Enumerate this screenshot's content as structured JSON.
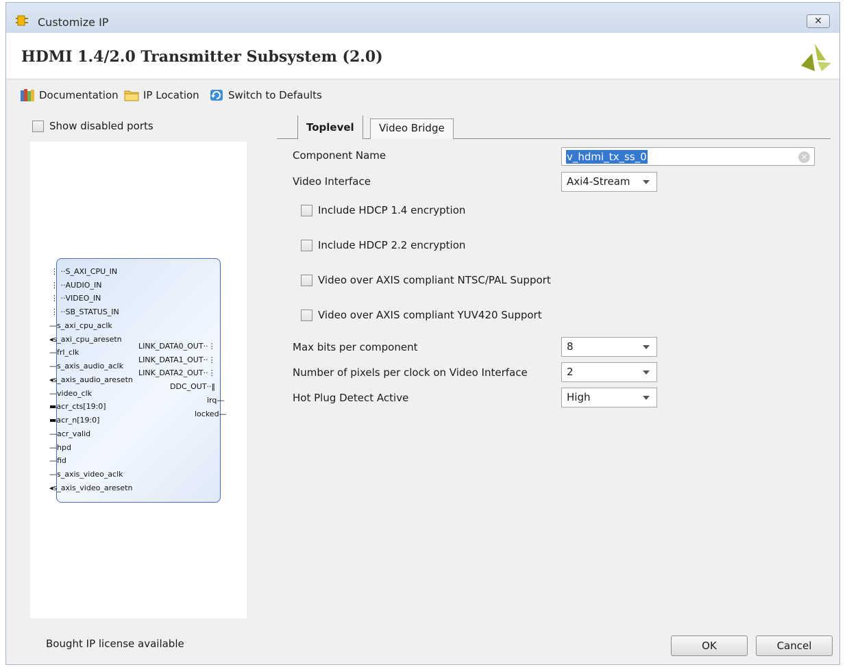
{
  "window": {
    "title": "Customize IP",
    "close_glyph": "✕"
  },
  "header": {
    "ip_title": "HDMI 1.4/2.0 Transmitter Subsystem (2.0)",
    "logo_icon": "xilinx-logo"
  },
  "toolbar": {
    "documentation": "Documentation",
    "ip_location": "IP Location",
    "switch_defaults": "Switch to Defaults"
  },
  "left": {
    "show_disabled_ports": "Show disabled ports",
    "ports_left": [
      "S_AXI_CPU_IN",
      "AUDIO_IN",
      "VIDEO_IN",
      "SB_STATUS_IN",
      "s_axi_cpu_aclk",
      "s_axi_cpu_aresetn",
      "frl_clk",
      "s_axis_audio_aclk",
      "s_axis_audio_aresetn",
      "video_clk",
      "acr_cts[19:0]",
      "acr_n[19:0]",
      "acr_valid",
      "hpd",
      "fid",
      "s_axis_video_aclk",
      "s_axis_video_aresetn"
    ],
    "ports_right": [
      "LINK_DATA0_OUT",
      "LINK_DATA1_OUT",
      "LINK_DATA2_OUT",
      "DDC_OUT",
      "irq",
      "locked"
    ]
  },
  "tabs": {
    "toplevel": "Toplevel",
    "video_bridge": "Video Bridge"
  },
  "form": {
    "component_name_label": "Component Name",
    "component_name_value": "v_hdmi_tx_ss_0",
    "video_interface_label": "Video Interface",
    "video_interface_value": "Axi4-Stream",
    "hdcp14": "Include HDCP 1.4 encryption",
    "hdcp22": "Include HDCP 2.2 encryption",
    "ntsc_pal": "Video over AXIS compliant NTSC/PAL Support",
    "yuv420": "Video over AXIS compliant YUV420 Support",
    "max_bits_label": "Max bits per component",
    "max_bits_value": "8",
    "pixels_per_clock_label": "Number of pixels per clock on Video Interface",
    "pixels_per_clock_value": "2",
    "hpd_active_label": "Hot Plug Detect Active",
    "hpd_active_value": "High"
  },
  "footer": {
    "license": "Bought IP license available",
    "ok": "OK",
    "cancel": "Cancel"
  }
}
